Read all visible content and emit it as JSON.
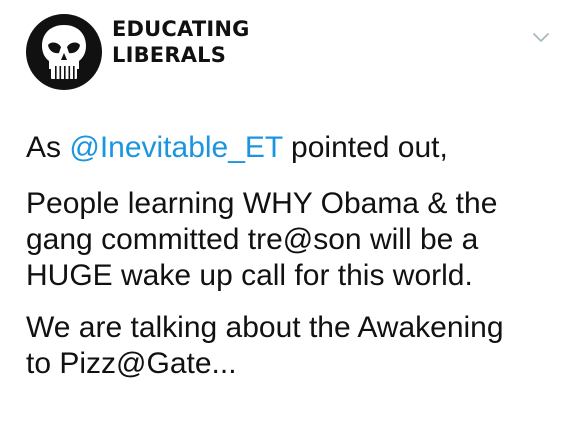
{
  "account": {
    "name_line1": "EDUCATING",
    "name_line2": "LIBERALS",
    "avatar_icon": "punisher-skull-icon",
    "avatar_bg": "#111111"
  },
  "menu": {
    "icon": "chevron-down-icon",
    "icon_color": "#aab8c2"
  },
  "tweet": {
    "p1_prefix": "As ",
    "mention": "@Inevitable_ET",
    "p1_suffix": " pointed out,",
    "p2_line1": "People learning WHY Obama & the",
    "p2_line2": "gang committed tre@son will be a",
    "p2_line3": "HUGE wake up call for this world.",
    "p3_line1": "We are talking about the Awakening",
    "p3_line2": "to Pizz@Gate...",
    "mention_color": "#1b95e0"
  }
}
